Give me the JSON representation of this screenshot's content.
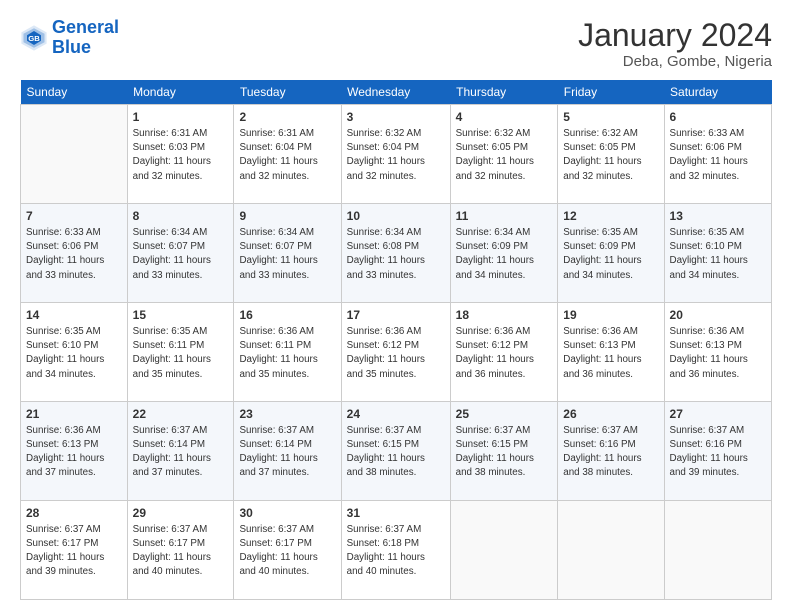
{
  "header": {
    "logo_line1": "General",
    "logo_line2": "Blue",
    "main_title": "January 2024",
    "subtitle": "Deba, Gombe, Nigeria"
  },
  "days_of_week": [
    "Sunday",
    "Monday",
    "Tuesday",
    "Wednesday",
    "Thursday",
    "Friday",
    "Saturday"
  ],
  "weeks": [
    [
      {
        "day": "",
        "sunrise": "",
        "sunset": "",
        "daylight": ""
      },
      {
        "day": "1",
        "sunrise": "Sunrise: 6:31 AM",
        "sunset": "Sunset: 6:03 PM",
        "daylight": "Daylight: 11 hours and 32 minutes."
      },
      {
        "day": "2",
        "sunrise": "Sunrise: 6:31 AM",
        "sunset": "Sunset: 6:04 PM",
        "daylight": "Daylight: 11 hours and 32 minutes."
      },
      {
        "day": "3",
        "sunrise": "Sunrise: 6:32 AM",
        "sunset": "Sunset: 6:04 PM",
        "daylight": "Daylight: 11 hours and 32 minutes."
      },
      {
        "day": "4",
        "sunrise": "Sunrise: 6:32 AM",
        "sunset": "Sunset: 6:05 PM",
        "daylight": "Daylight: 11 hours and 32 minutes."
      },
      {
        "day": "5",
        "sunrise": "Sunrise: 6:32 AM",
        "sunset": "Sunset: 6:05 PM",
        "daylight": "Daylight: 11 hours and 32 minutes."
      },
      {
        "day": "6",
        "sunrise": "Sunrise: 6:33 AM",
        "sunset": "Sunset: 6:06 PM",
        "daylight": "Daylight: 11 hours and 32 minutes."
      }
    ],
    [
      {
        "day": "7",
        "sunrise": "Sunrise: 6:33 AM",
        "sunset": "Sunset: 6:06 PM",
        "daylight": "Daylight: 11 hours and 33 minutes."
      },
      {
        "day": "8",
        "sunrise": "Sunrise: 6:34 AM",
        "sunset": "Sunset: 6:07 PM",
        "daylight": "Daylight: 11 hours and 33 minutes."
      },
      {
        "day": "9",
        "sunrise": "Sunrise: 6:34 AM",
        "sunset": "Sunset: 6:07 PM",
        "daylight": "Daylight: 11 hours and 33 minutes."
      },
      {
        "day": "10",
        "sunrise": "Sunrise: 6:34 AM",
        "sunset": "Sunset: 6:08 PM",
        "daylight": "Daylight: 11 hours and 33 minutes."
      },
      {
        "day": "11",
        "sunrise": "Sunrise: 6:34 AM",
        "sunset": "Sunset: 6:09 PM",
        "daylight": "Daylight: 11 hours and 34 minutes."
      },
      {
        "day": "12",
        "sunrise": "Sunrise: 6:35 AM",
        "sunset": "Sunset: 6:09 PM",
        "daylight": "Daylight: 11 hours and 34 minutes."
      },
      {
        "day": "13",
        "sunrise": "Sunrise: 6:35 AM",
        "sunset": "Sunset: 6:10 PM",
        "daylight": "Daylight: 11 hours and 34 minutes."
      }
    ],
    [
      {
        "day": "14",
        "sunrise": "Sunrise: 6:35 AM",
        "sunset": "Sunset: 6:10 PM",
        "daylight": "Daylight: 11 hours and 34 minutes."
      },
      {
        "day": "15",
        "sunrise": "Sunrise: 6:35 AM",
        "sunset": "Sunset: 6:11 PM",
        "daylight": "Daylight: 11 hours and 35 minutes."
      },
      {
        "day": "16",
        "sunrise": "Sunrise: 6:36 AM",
        "sunset": "Sunset: 6:11 PM",
        "daylight": "Daylight: 11 hours and 35 minutes."
      },
      {
        "day": "17",
        "sunrise": "Sunrise: 6:36 AM",
        "sunset": "Sunset: 6:12 PM",
        "daylight": "Daylight: 11 hours and 35 minutes."
      },
      {
        "day": "18",
        "sunrise": "Sunrise: 6:36 AM",
        "sunset": "Sunset: 6:12 PM",
        "daylight": "Daylight: 11 hours and 36 minutes."
      },
      {
        "day": "19",
        "sunrise": "Sunrise: 6:36 AM",
        "sunset": "Sunset: 6:13 PM",
        "daylight": "Daylight: 11 hours and 36 minutes."
      },
      {
        "day": "20",
        "sunrise": "Sunrise: 6:36 AM",
        "sunset": "Sunset: 6:13 PM",
        "daylight": "Daylight: 11 hours and 36 minutes."
      }
    ],
    [
      {
        "day": "21",
        "sunrise": "Sunrise: 6:36 AM",
        "sunset": "Sunset: 6:13 PM",
        "daylight": "Daylight: 11 hours and 37 minutes."
      },
      {
        "day": "22",
        "sunrise": "Sunrise: 6:37 AM",
        "sunset": "Sunset: 6:14 PM",
        "daylight": "Daylight: 11 hours and 37 minutes."
      },
      {
        "day": "23",
        "sunrise": "Sunrise: 6:37 AM",
        "sunset": "Sunset: 6:14 PM",
        "daylight": "Daylight: 11 hours and 37 minutes."
      },
      {
        "day": "24",
        "sunrise": "Sunrise: 6:37 AM",
        "sunset": "Sunset: 6:15 PM",
        "daylight": "Daylight: 11 hours and 38 minutes."
      },
      {
        "day": "25",
        "sunrise": "Sunrise: 6:37 AM",
        "sunset": "Sunset: 6:15 PM",
        "daylight": "Daylight: 11 hours and 38 minutes."
      },
      {
        "day": "26",
        "sunrise": "Sunrise: 6:37 AM",
        "sunset": "Sunset: 6:16 PM",
        "daylight": "Daylight: 11 hours and 38 minutes."
      },
      {
        "day": "27",
        "sunrise": "Sunrise: 6:37 AM",
        "sunset": "Sunset: 6:16 PM",
        "daylight": "Daylight: 11 hours and 39 minutes."
      }
    ],
    [
      {
        "day": "28",
        "sunrise": "Sunrise: 6:37 AM",
        "sunset": "Sunset: 6:17 PM",
        "daylight": "Daylight: 11 hours and 39 minutes."
      },
      {
        "day": "29",
        "sunrise": "Sunrise: 6:37 AM",
        "sunset": "Sunset: 6:17 PM",
        "daylight": "Daylight: 11 hours and 40 minutes."
      },
      {
        "day": "30",
        "sunrise": "Sunrise: 6:37 AM",
        "sunset": "Sunset: 6:17 PM",
        "daylight": "Daylight: 11 hours and 40 minutes."
      },
      {
        "day": "31",
        "sunrise": "Sunrise: 6:37 AM",
        "sunset": "Sunset: 6:18 PM",
        "daylight": "Daylight: 11 hours and 40 minutes."
      },
      {
        "day": "",
        "sunrise": "",
        "sunset": "",
        "daylight": ""
      },
      {
        "day": "",
        "sunrise": "",
        "sunset": "",
        "daylight": ""
      },
      {
        "day": "",
        "sunrise": "",
        "sunset": "",
        "daylight": ""
      }
    ]
  ]
}
